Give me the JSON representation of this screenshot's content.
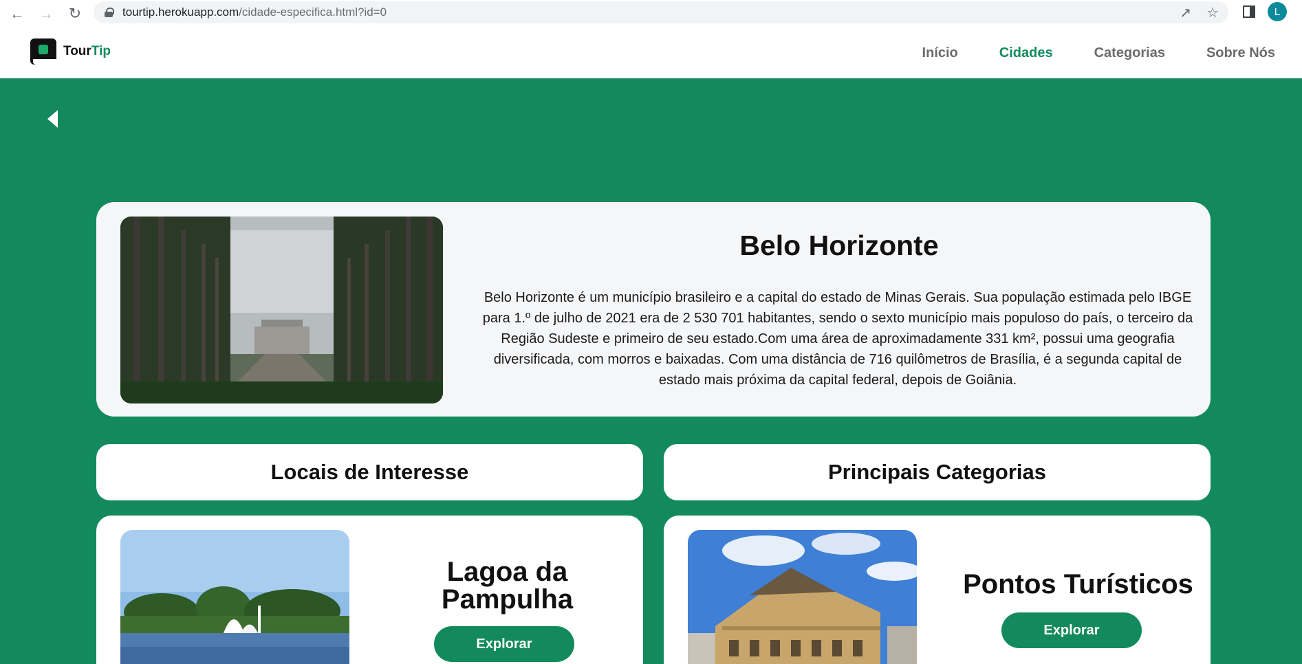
{
  "browser": {
    "url_host": "tourtip.herokuapp.com",
    "url_path": "/cidade-especifica.html?id=0",
    "profile_initial": "L",
    "icons": [
      "back-arrow-icon",
      "forward-arrow-icon",
      "reload-icon",
      "lock-icon",
      "share-icon",
      "star-icon",
      "side-panel-icon"
    ]
  },
  "site": {
    "logo_part1": "Tour",
    "logo_part2": "Tip",
    "nav": [
      {
        "label": "Início",
        "active": false
      },
      {
        "label": "Cidades",
        "active": true
      },
      {
        "label": "Categorias",
        "active": false
      },
      {
        "label": "Sobre Nós",
        "active": false
      }
    ],
    "colors": {
      "brand": "#128a5e",
      "card": "#f5f6f8"
    }
  },
  "city": {
    "name": "Belo Horizonte",
    "description": "Belo Horizonte é um município brasileiro e a capital do estado de Minas Gerais. Sua população estimada pelo IBGE para 1.º de julho de 2021 era de 2 530 701 habitantes, sendo o sexto município mais populoso do país, o terceiro da Região Sudeste e primeiro de seu estado.Com uma área de aproximadamente 331 km², possui uma geografia diversificada, com morros e baixadas. Com uma distância de 716 quilômetros de Brasília, é a segunda capital de estado mais próxima da capital federal, depois de Goiânia."
  },
  "sections": {
    "locais": "Locais de Interesse",
    "categorias": "Principais Categorias"
  },
  "cards": {
    "local": {
      "title": "Lagoa da Pampulha",
      "button": "Explorar"
    },
    "categoria": {
      "title": "Pontos Turísticos",
      "button": "Explorar"
    }
  }
}
